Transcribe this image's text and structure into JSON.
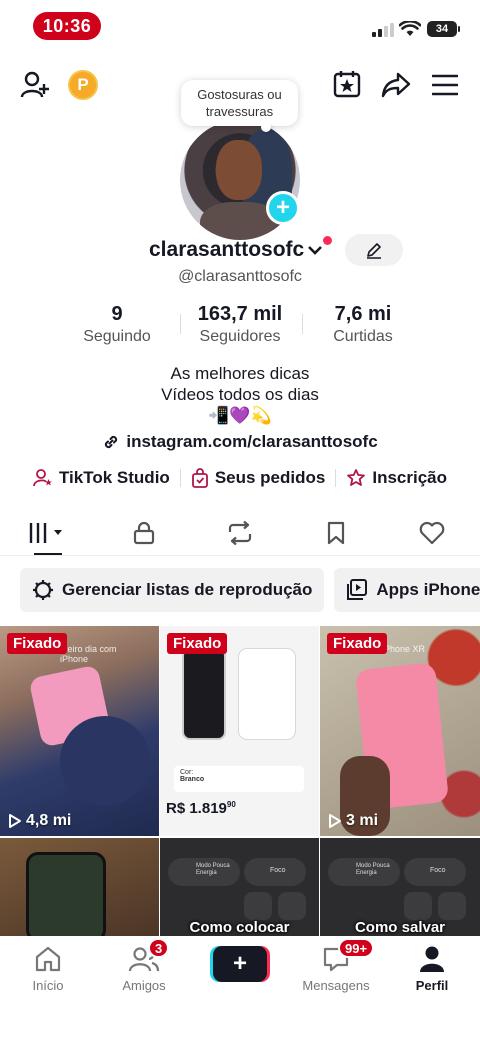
{
  "status": {
    "time": "10:36",
    "battery": "34"
  },
  "profile": {
    "bubble_text": "Gostosuras ou travessuras",
    "username": "clarasanttosofc",
    "handle": "@clarasanttosofc",
    "stats": [
      {
        "value": "9",
        "label": "Seguindo"
      },
      {
        "value": "163,7 mil",
        "label": "Seguidores"
      },
      {
        "value": "7,6 mi",
        "label": "Curtidas"
      }
    ],
    "bio_line1": "As melhores dicas",
    "bio_line2": "Vídeos todos os dias",
    "bio_emojis": "📲💜💫",
    "link": "instagram.com/clarasanttosofc"
  },
  "actions": {
    "studio": "TikTok Studio",
    "orders": "Seus pedidos",
    "subscription": "Inscrição"
  },
  "chips": {
    "playlists": "Gerenciar listas de reprodução",
    "apps": "Apps iPhone"
  },
  "videos": {
    "pinned_label": "Fixado",
    "v1_views": "4,8 mi",
    "v1_caption": "meiro dia com iPhone",
    "v2_price": "R$ 1.819",
    "v2_cents": "90",
    "v2_color_label": "Cor:",
    "v2_color": "Branco",
    "v3_views": "3 mi",
    "v3_caption": "iPhone XR",
    "v5_text": "Como colocar",
    "v6_text": "Como salvar",
    "v5_mode": "Modo Pouca Energia",
    "v5_focus": "Foco"
  },
  "nav": {
    "home": "Início",
    "friends": "Amigos",
    "friends_badge": "3",
    "messages": "Mensagens",
    "messages_badge": "99+",
    "profile": "Perfil"
  },
  "colors": {
    "accent": "#fe2c55",
    "cyan": "#20d5ec",
    "pin": "#d0021b"
  }
}
